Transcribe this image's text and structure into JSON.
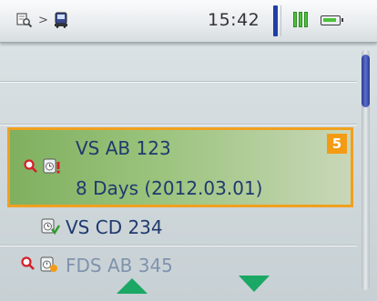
{
  "statusbar": {
    "breadcrumb_separator": ">",
    "clock": "15:42",
    "breadcrumb_icons": [
      "search-document-icon",
      "vehicle-icon"
    ],
    "signal_icon": "signal-strength-icon",
    "battery_icon": "battery-icon"
  },
  "list": {
    "selected": {
      "title": "VS AB 123",
      "subtitle": "8 Days (2012.03.01)",
      "badge": "5",
      "icons": [
        "search-alert-icon",
        "clock-alert-icon"
      ]
    },
    "items": [
      {
        "label": "VS CD 234",
        "icons": [
          "clock-check-icon"
        ]
      },
      {
        "label": "FDS AB 345",
        "icons": [
          "search-alert-icon",
          "clock-warning-icon"
        ]
      }
    ]
  },
  "colors": {
    "accent": "#1f3fa8",
    "selection_border": "#f0a020",
    "selection_fill": "#8bb86b",
    "badge": "#f49b14",
    "text": "#1e3a6e",
    "arrows": "#1aa864"
  }
}
